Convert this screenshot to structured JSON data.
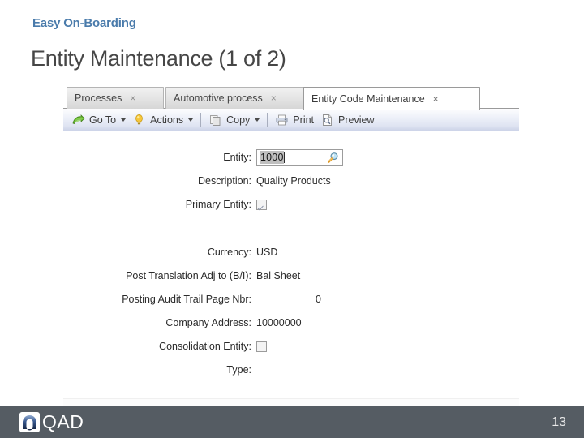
{
  "slide": {
    "kicker": "Easy On-Boarding",
    "title": "Entity Maintenance (1 of 2)",
    "kicker_color": "#4a7bab",
    "title_color": "#464646"
  },
  "app": {
    "tabs": [
      {
        "label": "Processes",
        "close": "×",
        "active": false
      },
      {
        "label": "Automotive process",
        "close": "×",
        "active": false
      },
      {
        "label": "Entity Code Maintenance",
        "close": "×",
        "active": true
      }
    ],
    "toolbar": {
      "goto_label": "Go To",
      "goto_icon": "green-arrow-icon",
      "actions_label": "Actions",
      "actions_icon": "lightbulb-icon",
      "copy_label": "Copy",
      "copy_icon": "copy-pages-icon",
      "print_label": "Print",
      "print_icon": "printer-icon",
      "preview_label": "Preview",
      "preview_icon": "preview-page-icon"
    },
    "form": {
      "entity": {
        "label": "Entity:",
        "value": "1000",
        "lookup_icon": "magnifier-icon"
      },
      "description": {
        "label": "Description:",
        "value": "Quality Products"
      },
      "primary_entity": {
        "label": "Primary Entity:",
        "checked": true
      },
      "currency": {
        "label": "Currency:",
        "value": "USD"
      },
      "post_translation": {
        "label": "Post Translation Adj to (B/I):",
        "value": "Bal Sheet"
      },
      "audit_page_nbr": {
        "label": "Posting Audit Trail Page Nbr:",
        "value": "0"
      },
      "company_address": {
        "label": "Company Address:",
        "value": "10000000"
      },
      "consolidation_entity": {
        "label": "Consolidation Entity:",
        "checked": false
      },
      "type": {
        "label": "Type:",
        "value": ""
      }
    }
  },
  "footer": {
    "logo_text": "QAD",
    "logo_mark": "qad-arch-logo-icon",
    "page_number": "13",
    "bar_color": "#555c63"
  }
}
